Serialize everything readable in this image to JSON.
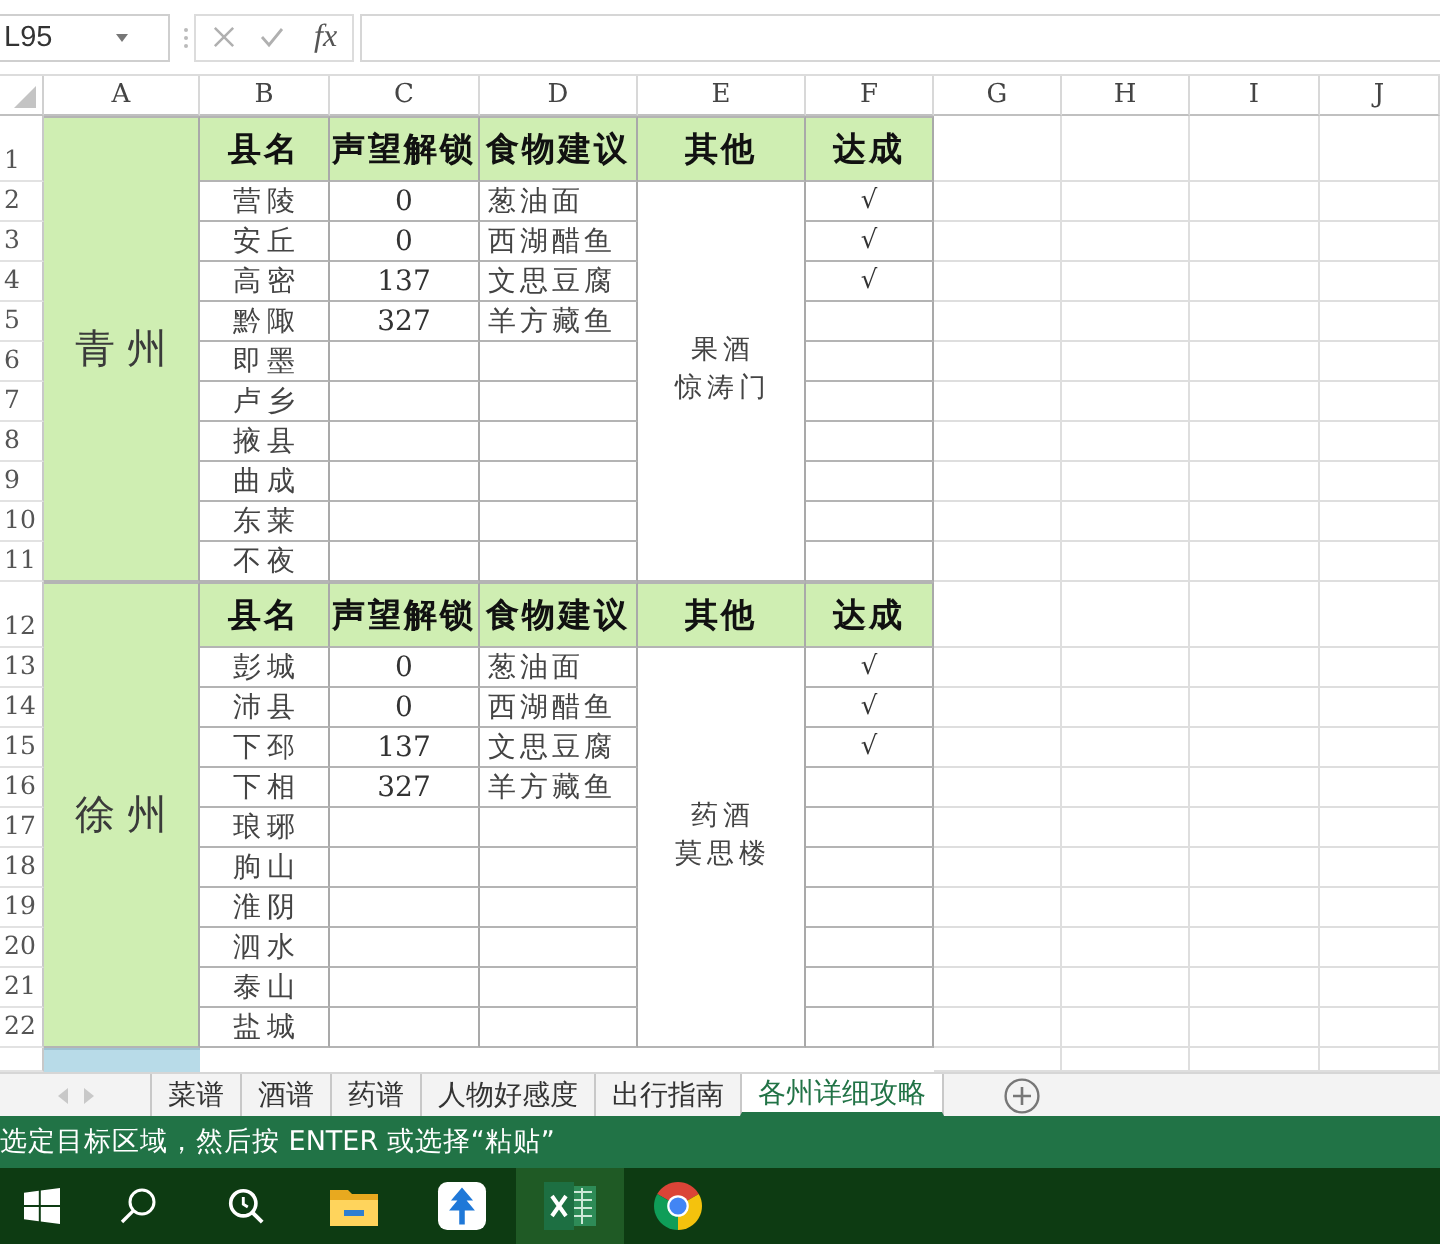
{
  "name_box": {
    "value": "L95"
  },
  "formula_bar": {
    "function_label": "fx"
  },
  "columns": [
    "A",
    "B",
    "C",
    "D",
    "E",
    "F",
    "G",
    "H",
    "I",
    "J"
  ],
  "sections": [
    {
      "row_numbers": [
        "1",
        "2",
        "3",
        "4",
        "5",
        "6",
        "7",
        "8",
        "9",
        "10",
        "11"
      ],
      "region": "青州",
      "headers": [
        "县名",
        "声望解锁",
        "食物建议",
        "其他",
        "达成"
      ],
      "other": [
        "果酒",
        "惊涛门"
      ],
      "rows": [
        {
          "county": "营陵",
          "reputation": "0",
          "food": "葱油面",
          "achieved": "√"
        },
        {
          "county": "安丘",
          "reputation": "0",
          "food": "西湖醋鱼",
          "achieved": "√"
        },
        {
          "county": "高密",
          "reputation": "137",
          "food": "文思豆腐",
          "achieved": "√"
        },
        {
          "county": "黔陬",
          "reputation": "327",
          "food": "羊方藏鱼"
        },
        {
          "county": "即墨"
        },
        {
          "county": "卢乡"
        },
        {
          "county": "掖县"
        },
        {
          "county": "曲成"
        },
        {
          "county": "东莱"
        },
        {
          "county": "不夜"
        }
      ]
    },
    {
      "row_numbers": [
        "12",
        "13",
        "14",
        "15",
        "16",
        "17",
        "18",
        "19",
        "20",
        "21",
        "22"
      ],
      "region": "徐州",
      "headers": [
        "县名",
        "声望解锁",
        "食物建议",
        "其他",
        "达成"
      ],
      "other": [
        "药酒",
        "莫思楼"
      ],
      "rows": [
        {
          "county": "彭城",
          "reputation": "0",
          "food": "葱油面",
          "achieved": "√"
        },
        {
          "county": "沛县",
          "reputation": "0",
          "food": "西湖醋鱼",
          "achieved": "√"
        },
        {
          "county": "下邳",
          "reputation": "137",
          "food": "文思豆腐",
          "achieved": "√"
        },
        {
          "county": "下相",
          "reputation": "327",
          "food": "羊方藏鱼"
        },
        {
          "county": "琅琊"
        },
        {
          "county": "朐山"
        },
        {
          "county": "淮阴"
        },
        {
          "county": "泗水"
        },
        {
          "county": "泰山"
        },
        {
          "county": "盐城"
        }
      ]
    }
  ],
  "sheet_tabs": [
    {
      "label": "菜谱",
      "selected": false
    },
    {
      "label": "酒谱",
      "selected": false
    },
    {
      "label": "药谱",
      "selected": false
    },
    {
      "label": "人物好感度",
      "selected": false
    },
    {
      "label": "出行指南",
      "selected": false
    },
    {
      "label": "各州详细攻略",
      "selected": true
    }
  ],
  "status_bar": {
    "text": "选定目标区域，然后按 ENTER 或选择“粘贴”"
  },
  "taskbar": {
    "apps": [
      {
        "kind": "start",
        "selected": false
      },
      {
        "kind": "search",
        "selected": false
      },
      {
        "kind": "assistant",
        "selected": false
      },
      {
        "kind": "files",
        "selected": false
      },
      {
        "kind": "tree",
        "selected": false
      },
      {
        "kind": "spreadsheet",
        "selected": true
      },
      {
        "kind": "browser",
        "selected": false
      }
    ]
  }
}
